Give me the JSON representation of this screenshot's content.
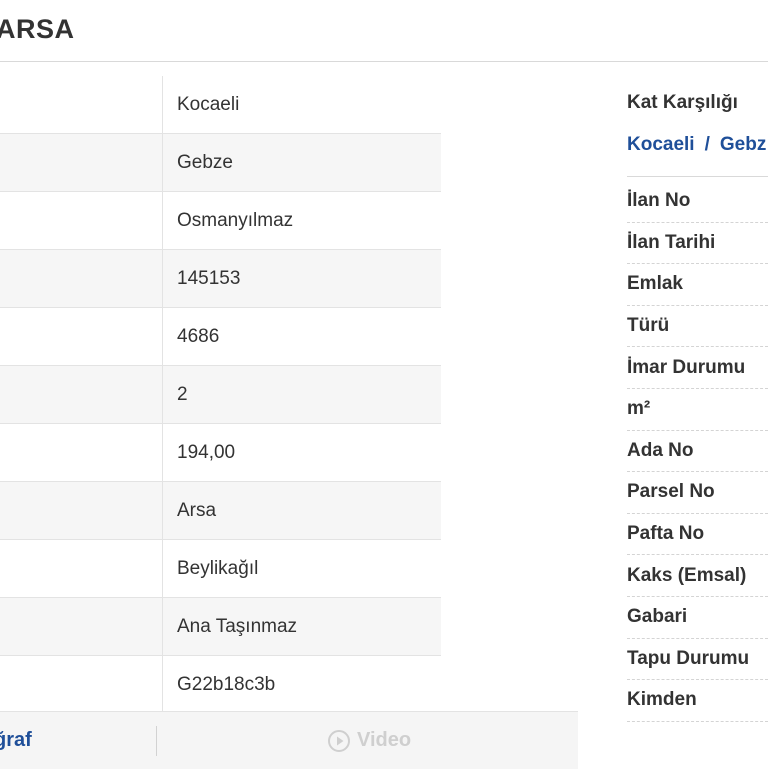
{
  "header": {
    "title": "ARSA"
  },
  "details_table": {
    "values": [
      "Kocaeli",
      "Gebze",
      "Osmanyılmaz",
      "145153",
      "4686",
      "2",
      "194,00",
      "Arsa",
      "Beylikağıl",
      "Ana Taşınmaz",
      "G22b18c3b"
    ]
  },
  "media_tabs": {
    "photo_label": "ğraf",
    "video_label": "Video",
    "video_icon": "play-circle-icon"
  },
  "summary": {
    "price_label": "Kat Karşılığı",
    "breadcrumb": [
      "Kocaeli",
      "Gebz"
    ],
    "breadcrumb_separator": "/",
    "info_labels": [
      "İlan No",
      "İlan Tarihi",
      "Emlak",
      "Türü",
      "İmar Durumu",
      "m²",
      "Ada No",
      "Parsel No",
      "Pafta No",
      "Kaks (Emsal)",
      "Gabari",
      "Tapu Durumu",
      "Kimden"
    ]
  },
  "colors": {
    "link": "#1f4f99",
    "text": "#333333",
    "disabled": "#cfcfcf"
  }
}
